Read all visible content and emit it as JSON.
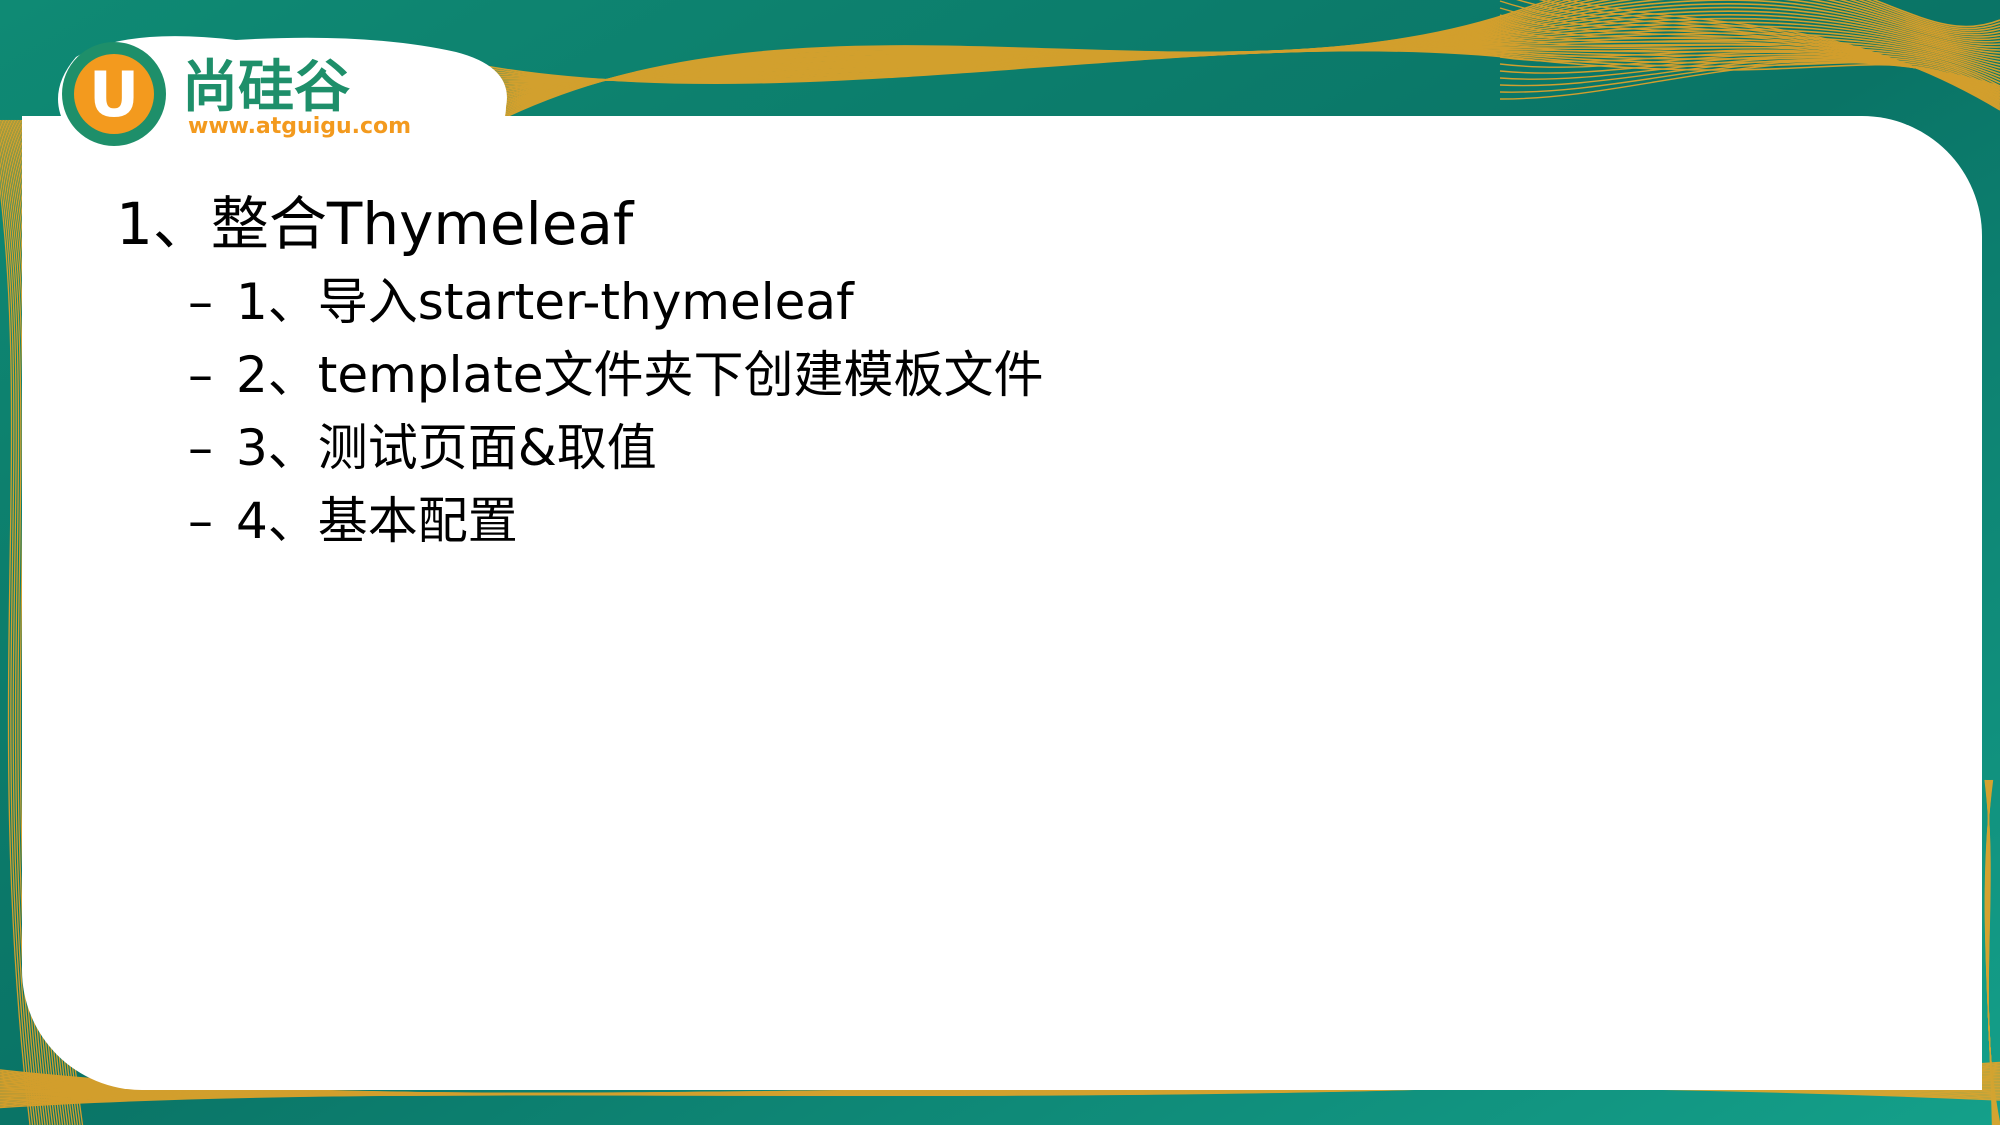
{
  "logo": {
    "letter": "U",
    "name": "尚硅谷",
    "url": "www.atguigu.com"
  },
  "slide": {
    "heading": "1、整合Thymeleaf",
    "bullet": "–",
    "items": [
      {
        "text": "1、导入starter-thymeleaf"
      },
      {
        "text": "2、template文件夹下创建模板文件"
      },
      {
        "text": "3、测试页面&取值"
      },
      {
        "text": "4、基本配置"
      }
    ]
  },
  "colors": {
    "background": "#0d7a6e",
    "accent_lines": "#f5a623",
    "logo_green": "#1e8f6a",
    "logo_orange": "#f39a1e",
    "panel": "#ffffff"
  }
}
